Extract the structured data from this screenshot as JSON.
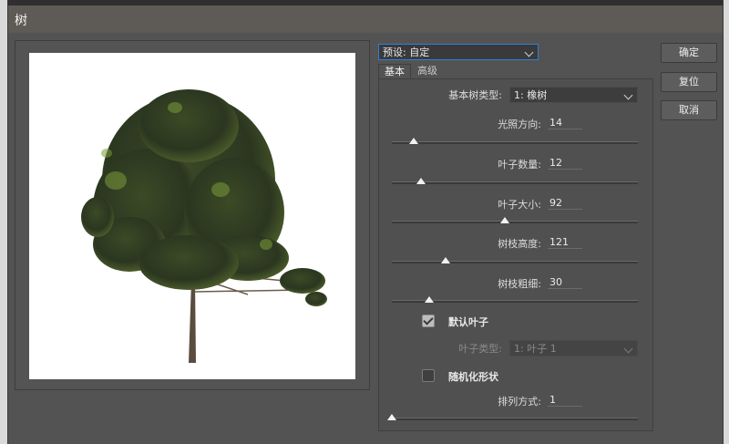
{
  "window": {
    "title": "树"
  },
  "preset": {
    "value": "预设: 自定"
  },
  "buttons": {
    "ok": "确定",
    "reset": "复位",
    "cancel": "取消"
  },
  "tabs": {
    "basic": "基本",
    "advanced": "高级"
  },
  "tree_type": {
    "label": "基本树类型:",
    "value": "1: 橡树"
  },
  "sliders": {
    "light_direction": {
      "label": "光照方向:",
      "value": "14",
      "fraction": 0.09
    },
    "leaf_count": {
      "label": "叶子数量:",
      "value": "12",
      "fraction": 0.12
    },
    "leaf_size": {
      "label": "叶子大小:",
      "value": "92",
      "fraction": 0.46
    },
    "branch_height": {
      "label": "树枝高度:",
      "value": "121",
      "fraction": 0.22
    },
    "branch_thickness": {
      "label": "树枝粗细:",
      "value": "30",
      "fraction": 0.15
    },
    "arrangement": {
      "label": "排列方式:",
      "value": "1",
      "fraction": 0.0
    }
  },
  "default_leaves": {
    "label": "默认叶子",
    "checked": true
  },
  "leaf_type": {
    "label": "叶子类型:",
    "value": "1: 叶子 1"
  },
  "randomize_shape": {
    "label": "随机化形状",
    "checked": false
  },
  "colors": {
    "accent": "#2f7fd6",
    "foliage_dark": "#2f3d20",
    "foliage_light": "#7a9a3a",
    "trunk": "#5a4c3e"
  }
}
